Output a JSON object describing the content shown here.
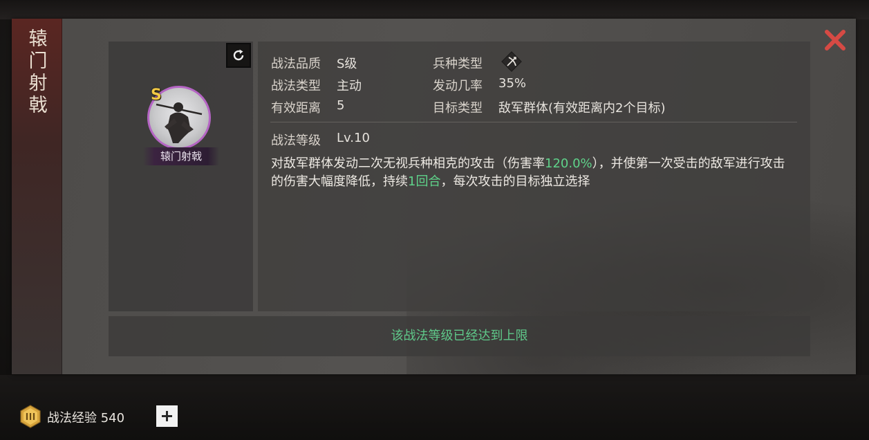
{
  "skill": {
    "title_vertical": "辕门射戟",
    "name": "辕门射戟",
    "grade_badge": "S"
  },
  "attributes": {
    "quality_label": "战法品质",
    "quality_value": "S级",
    "type_label": "战法类型",
    "type_value": "主动",
    "range_label": "有效距离",
    "range_value": "5",
    "troop_label": "兵种类型",
    "troop_icon": "bow-icon",
    "rate_label": "发动几率",
    "rate_value": "35%",
    "target_label": "目标类型",
    "target_value": "敌军群体(有效距离内2个目标)",
    "level_label": "战法等级",
    "level_value": "Lv.10"
  },
  "description": {
    "part1": "对敌军群体发动二次无视兵种相克的攻击（伤害率",
    "damage_rate": "120.0%",
    "part2": "），并使第一次受击的敌军进行攻击的伤害大幅度降低，持续",
    "duration": "1回合",
    "part3": "，每次攻击的目标独立选择"
  },
  "notice": "该战法等级已经达到上限",
  "bottom": {
    "exp_label": "战法经验 540"
  },
  "colors": {
    "highlight": "#5fd38a",
    "close": "#d64a44",
    "portrait_ring": "#b565c4",
    "grade": "#f1c845"
  }
}
